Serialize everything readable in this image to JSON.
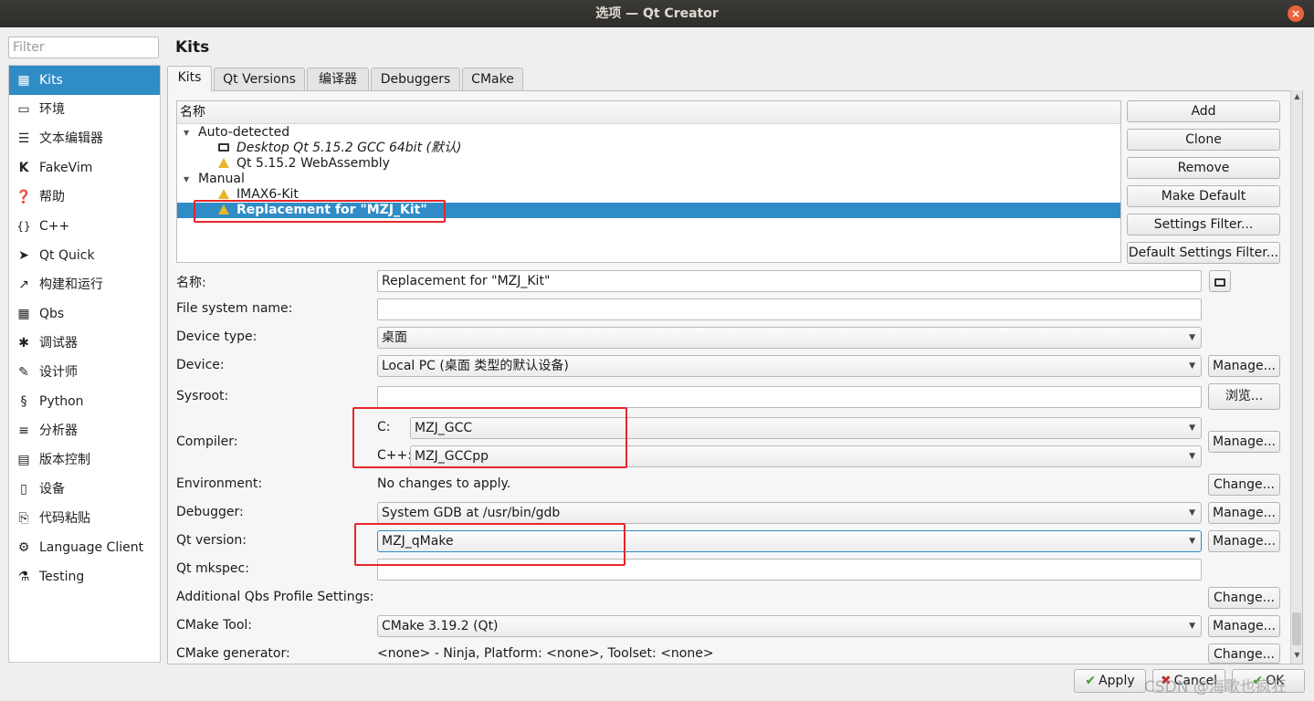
{
  "window": {
    "title": "选项 — Qt Creator",
    "close_glyph": "×"
  },
  "filter": {
    "placeholder": "Filter"
  },
  "sidebar": {
    "items": [
      {
        "label": "Kits",
        "icon": "kits-icon"
      },
      {
        "label": "环境",
        "icon": "monitor-icon"
      },
      {
        "label": "文本编辑器",
        "icon": "text-editor-icon"
      },
      {
        "label": "FakeVim",
        "icon": "fakevim-icon"
      },
      {
        "label": "帮助",
        "icon": "help-icon"
      },
      {
        "label": "C++",
        "icon": "braces-icon"
      },
      {
        "label": "Qt Quick",
        "icon": "qtquick-icon"
      },
      {
        "label": "构建和运行",
        "icon": "hammer-icon"
      },
      {
        "label": "Qbs",
        "icon": "qbs-icon"
      },
      {
        "label": "调试器",
        "icon": "bug-icon"
      },
      {
        "label": "设计师",
        "icon": "pen-icon"
      },
      {
        "label": "Python",
        "icon": "python-icon"
      },
      {
        "label": "分析器",
        "icon": "analyzer-icon"
      },
      {
        "label": "版本控制",
        "icon": "version-control-icon"
      },
      {
        "label": "设备",
        "icon": "device-icon"
      },
      {
        "label": "代码粘贴",
        "icon": "clipboard-icon"
      },
      {
        "label": "Language Client",
        "icon": "language-client-icon"
      },
      {
        "label": "Testing",
        "icon": "flask-icon"
      }
    ]
  },
  "main": {
    "title": "Kits",
    "tabs": [
      "Kits",
      "Qt Versions",
      "编译器",
      "Debuggers",
      "CMake"
    ],
    "tree": {
      "header": "名称",
      "auto_detected": "Auto-detected",
      "kit_desktop": "Desktop Qt 5.15.2 GCC 64bit (默认)",
      "kit_wasm": "Qt 5.15.2 WebAssembly",
      "manual": "Manual",
      "kit_imax": "IMAX6-Kit",
      "kit_replacement": "Replacement for \"MZJ_Kit\""
    },
    "side_buttons": [
      "Add",
      "Clone",
      "Remove",
      "Make Default",
      "Settings Filter...",
      "Default Settings Filter..."
    ],
    "form": {
      "name_label": "名称:",
      "name_value": "Replacement for \"MZJ_Kit\"",
      "fs_label": "File system name:",
      "fs_value": "",
      "device_type_label": "Device type:",
      "device_type_value": "桌面",
      "device_label": "Device:",
      "device_value": "Local PC (桌面 类型的默认设备)",
      "sysroot_label": "Sysroot:",
      "sysroot_value": "",
      "browse_label": "浏览...",
      "compiler_label": "Compiler:",
      "c_label": "C:",
      "c_value": "MZJ_GCC",
      "cpp_label": "C++:",
      "cpp_value": "MZJ_GCCpp",
      "env_label": "Environment:",
      "env_value": "No changes to apply.",
      "debugger_label": "Debugger:",
      "debugger_value": "System GDB at /usr/bin/gdb",
      "qt_version_label": "Qt version:",
      "qt_version_value": "MZJ_qMake",
      "mkspec_label": "Qt mkspec:",
      "mkspec_value": "",
      "qbs_label": "Additional Qbs Profile Settings:",
      "cmake_tool_label": "CMake Tool:",
      "cmake_tool_value": "CMake 3.19.2 (Qt)",
      "cmake_gen_label": "CMake generator:",
      "cmake_gen_value": "<none> - Ninja, Platform: <none>, Toolset: <none>",
      "manage_label": "Manage...",
      "change_label": "Change..."
    }
  },
  "footer": {
    "apply": "Apply",
    "cancel": "Cancel",
    "ok": "OK"
  },
  "watermark": "CSDN @海歌也疯狂",
  "colors": {
    "selection": "#308cc6",
    "highlight_box": "#e8262a",
    "warning": "#e8b62b"
  }
}
